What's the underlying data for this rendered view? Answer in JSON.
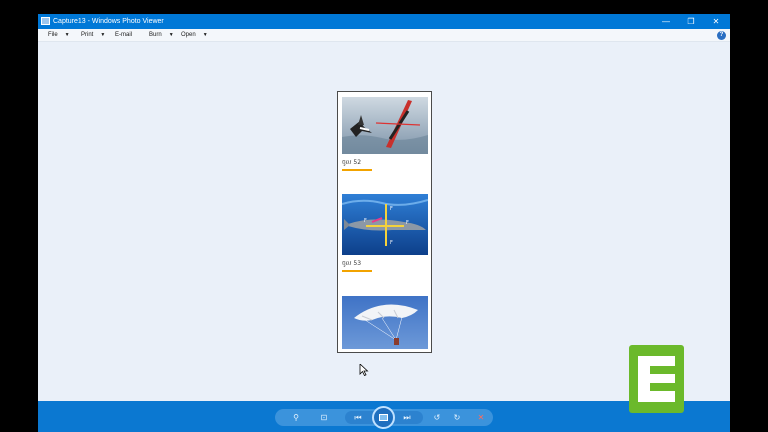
{
  "window": {
    "title": "Capture13 - Windows Photo Viewer"
  },
  "menu": {
    "file": "File",
    "print": "Print",
    "email": "E-mail",
    "burn": "Burn",
    "open": "Open"
  },
  "captions": {
    "fig52": "ចូល 52",
    "fig53": "ចូល 53"
  },
  "icons": {
    "minimize": "minimize-icon",
    "maximize": "restore-icon",
    "close": "close-icon",
    "help": "help-icon"
  },
  "colors": {
    "titlebar": "#0078d7",
    "bottombar": "#0b78d1",
    "accent_underline": "#f2a300"
  }
}
